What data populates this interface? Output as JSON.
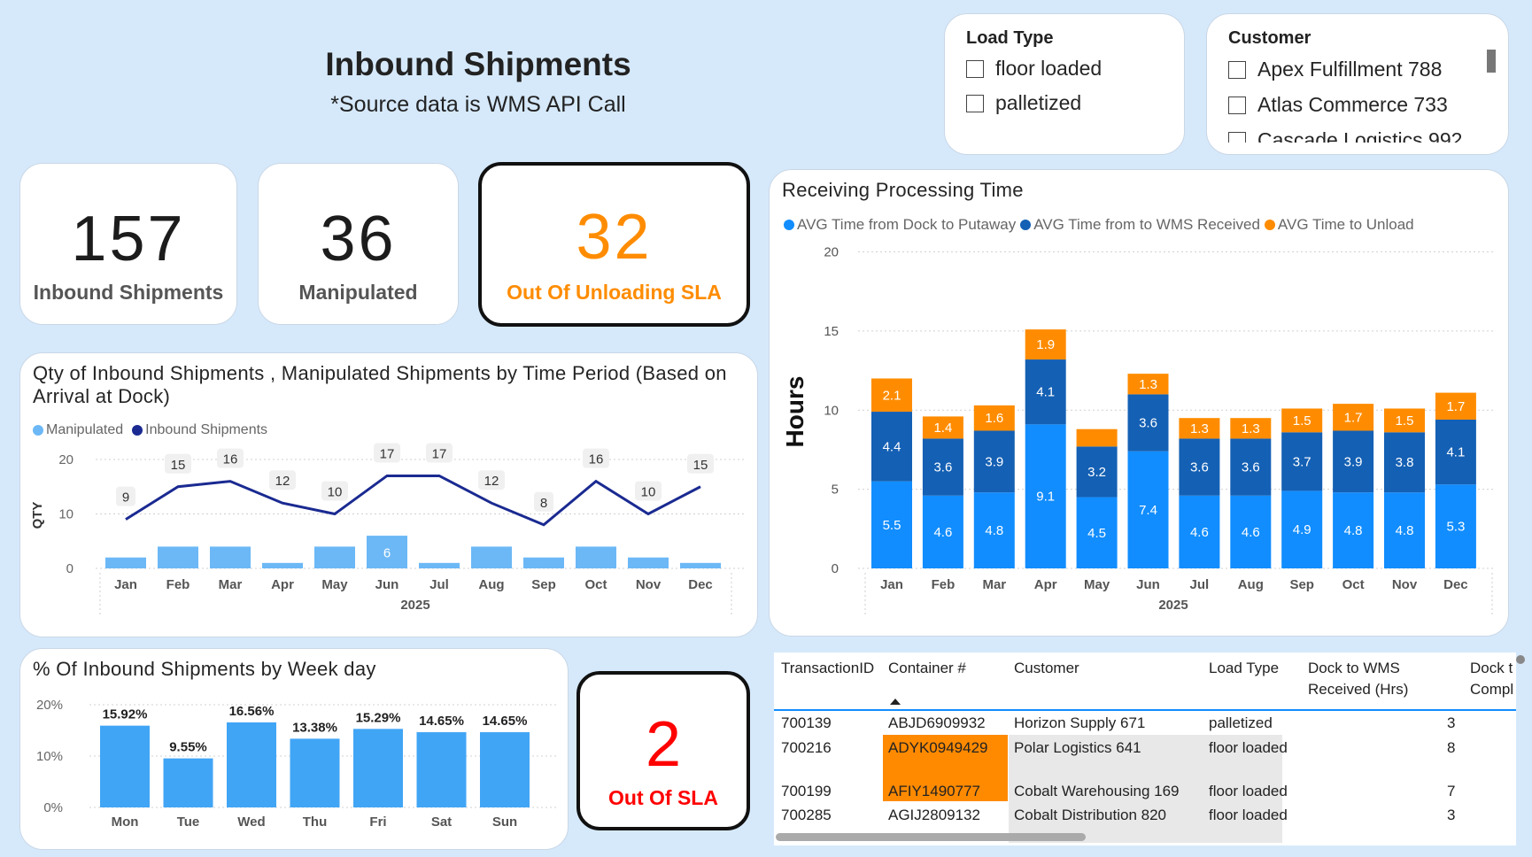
{
  "header": {
    "title": "Inbound Shipments",
    "subtitle": "*Source data is WMS API Call"
  },
  "kpis": {
    "inbound": {
      "value": "157",
      "label": "Inbound Shipments"
    },
    "manipulated": {
      "value": "36",
      "label": "Manipulated"
    },
    "unloading_sla": {
      "value": "32",
      "label": "Out Of Unloading SLA",
      "color": "#ff8c00"
    },
    "out_of_sla": {
      "value": "2",
      "label": "Out Of SLA",
      "color": "#ff0000"
    }
  },
  "slicers": {
    "load_type": {
      "title": "Load Type",
      "items": [
        "floor loaded",
        "palletized"
      ]
    },
    "customer": {
      "title": "Customer",
      "items": [
        "Apex Fulfillment 788",
        "Atlas Commerce 733",
        "Cascade Logistics 992"
      ]
    }
  },
  "charts": {
    "qty": {
      "title": "Qty of Inbound Shipments , Manipulated Shipments by Time Period (Based on Arrival at Dock)",
      "legend": [
        "Manipulated",
        "Inbound Shipments"
      ]
    },
    "receiving": {
      "title": "Receiving Processing Time",
      "legend": [
        "AVG Time from Dock to Putaway",
        "AVG Time from to WMS Received",
        "AVG Time to Unload"
      ]
    },
    "weekday": {
      "title": "% Of Inbound Shipments by Week day"
    }
  },
  "colors": {
    "light_blue": "#6cb8f6",
    "navy": "#1a2a91",
    "blue": "#118dff",
    "dark_blue": "#1460b4",
    "orange": "#ff8c00",
    "bar_blue": "#41a5f5"
  },
  "chart_data": [
    {
      "type": "bar",
      "title": "Qty of Inbound Shipments , Manipulated Shipments by Time Period (Based on Arrival at Dock)",
      "categories": [
        "Jan",
        "Feb",
        "Mar",
        "Apr",
        "May",
        "Jun",
        "Jul",
        "Aug",
        "Sep",
        "Oct",
        "Nov",
        "Dec"
      ],
      "year_label": "2025",
      "ylabel": "QTY",
      "yticks": [
        0,
        10,
        20
      ],
      "ylim": [
        0,
        20
      ],
      "series": [
        {
          "name": "Manipulated",
          "type": "bar",
          "values": [
            2,
            4,
            4,
            1,
            4,
            6,
            1,
            4,
            2,
            4,
            2,
            1
          ],
          "labels": [
            "",
            "",
            "",
            "",
            "",
            "6",
            "",
            "",
            "",
            "",
            "",
            ""
          ]
        },
        {
          "name": "Inbound Shipments",
          "type": "line",
          "values": [
            9,
            15,
            16,
            12,
            10,
            17,
            17,
            12,
            8,
            16,
            10,
            15
          ],
          "labels": [
            "9",
            "15",
            "16",
            "12",
            "10",
            "17",
            "17",
            "12",
            "8",
            "16",
            "10",
            "15"
          ]
        }
      ]
    },
    {
      "type": "bar",
      "stacked": true,
      "title": "Receiving Processing Time",
      "categories": [
        "Jan",
        "Feb",
        "Mar",
        "Apr",
        "May",
        "Jun",
        "Jul",
        "Aug",
        "Sep",
        "Oct",
        "Nov",
        "Dec"
      ],
      "year_label": "2025",
      "ylabel": "Hours",
      "yticks": [
        0,
        5,
        10,
        15,
        20
      ],
      "ylim": [
        0,
        20
      ],
      "series": [
        {
          "name": "AVG Time from Dock to Putaway",
          "values": [
            5.5,
            4.6,
            4.8,
            9.1,
            4.5,
            7.4,
            4.6,
            4.6,
            4.9,
            4.8,
            4.8,
            5.3
          ],
          "labels": [
            "5.5",
            "4.6",
            "4.8",
            "9.1",
            "4.5",
            "7.4",
            "4.6",
            "4.6",
            "4.9",
            "4.8",
            "4.8",
            "5.3"
          ]
        },
        {
          "name": "AVG Time from to WMS Received",
          "values": [
            4.4,
            3.6,
            3.9,
            4.1,
            3.2,
            3.6,
            3.6,
            3.6,
            3.7,
            3.9,
            3.8,
            4.1
          ],
          "labels": [
            "4.4",
            "3.6",
            "3.9",
            "4.1",
            "3.2",
            "3.6",
            "3.6",
            "3.6",
            "3.7",
            "3.9",
            "3.8",
            "4.1"
          ]
        },
        {
          "name": "AVG Time to Unload",
          "values": [
            2.1,
            1.4,
            1.6,
            1.9,
            1.1,
            1.3,
            1.3,
            1.3,
            1.5,
            1.7,
            1.5,
            1.7
          ],
          "labels": [
            "2.1",
            "1.4",
            "1.6",
            "1.9",
            "",
            "1.3",
            "1.3",
            "1.3",
            "1.5",
            "1.7",
            "1.5",
            "1.7"
          ]
        }
      ]
    },
    {
      "type": "bar",
      "title": "% Of Inbound Shipments by Week day",
      "categories": [
        "Mon",
        "Tue",
        "Wed",
        "Thu",
        "Fri",
        "Sat",
        "Sun"
      ],
      "values": [
        15.92,
        9.55,
        16.56,
        13.38,
        15.29,
        14.65,
        14.65
      ],
      "labels": [
        "15.92%",
        "9.55%",
        "16.56%",
        "13.38%",
        "15.29%",
        "14.65%",
        "14.65%"
      ],
      "yticks": [
        "0%",
        "10%",
        "20%"
      ],
      "ylim": [
        0,
        20
      ]
    }
  ],
  "table": {
    "columns": [
      "TransactionID",
      "Container #",
      "Customer",
      "Load Type",
      "Dock to WMS Received (Hrs)",
      "Dock t Compl"
    ],
    "rows": [
      {
        "id": "700139",
        "container": "ABJD6909932",
        "customer": "Horizon Supply 671",
        "load": "palletized",
        "hrs": "3",
        "highlight": false
      },
      {
        "id": "700216",
        "container": "ADYK0949429",
        "customer": "Polar Logistics 641",
        "load": "floor loaded",
        "hrs": "8",
        "highlight": true
      },
      {
        "id": "700199",
        "container": "AFIY1490777",
        "customer": "Cobalt Warehousing 169",
        "load": "floor loaded",
        "hrs": "7",
        "highlight": true
      },
      {
        "id": "700285",
        "container": "AGIJ2809132",
        "customer": "Cobalt Distribution 820",
        "load": "floor loaded",
        "hrs": "3",
        "highlight": false
      }
    ]
  }
}
